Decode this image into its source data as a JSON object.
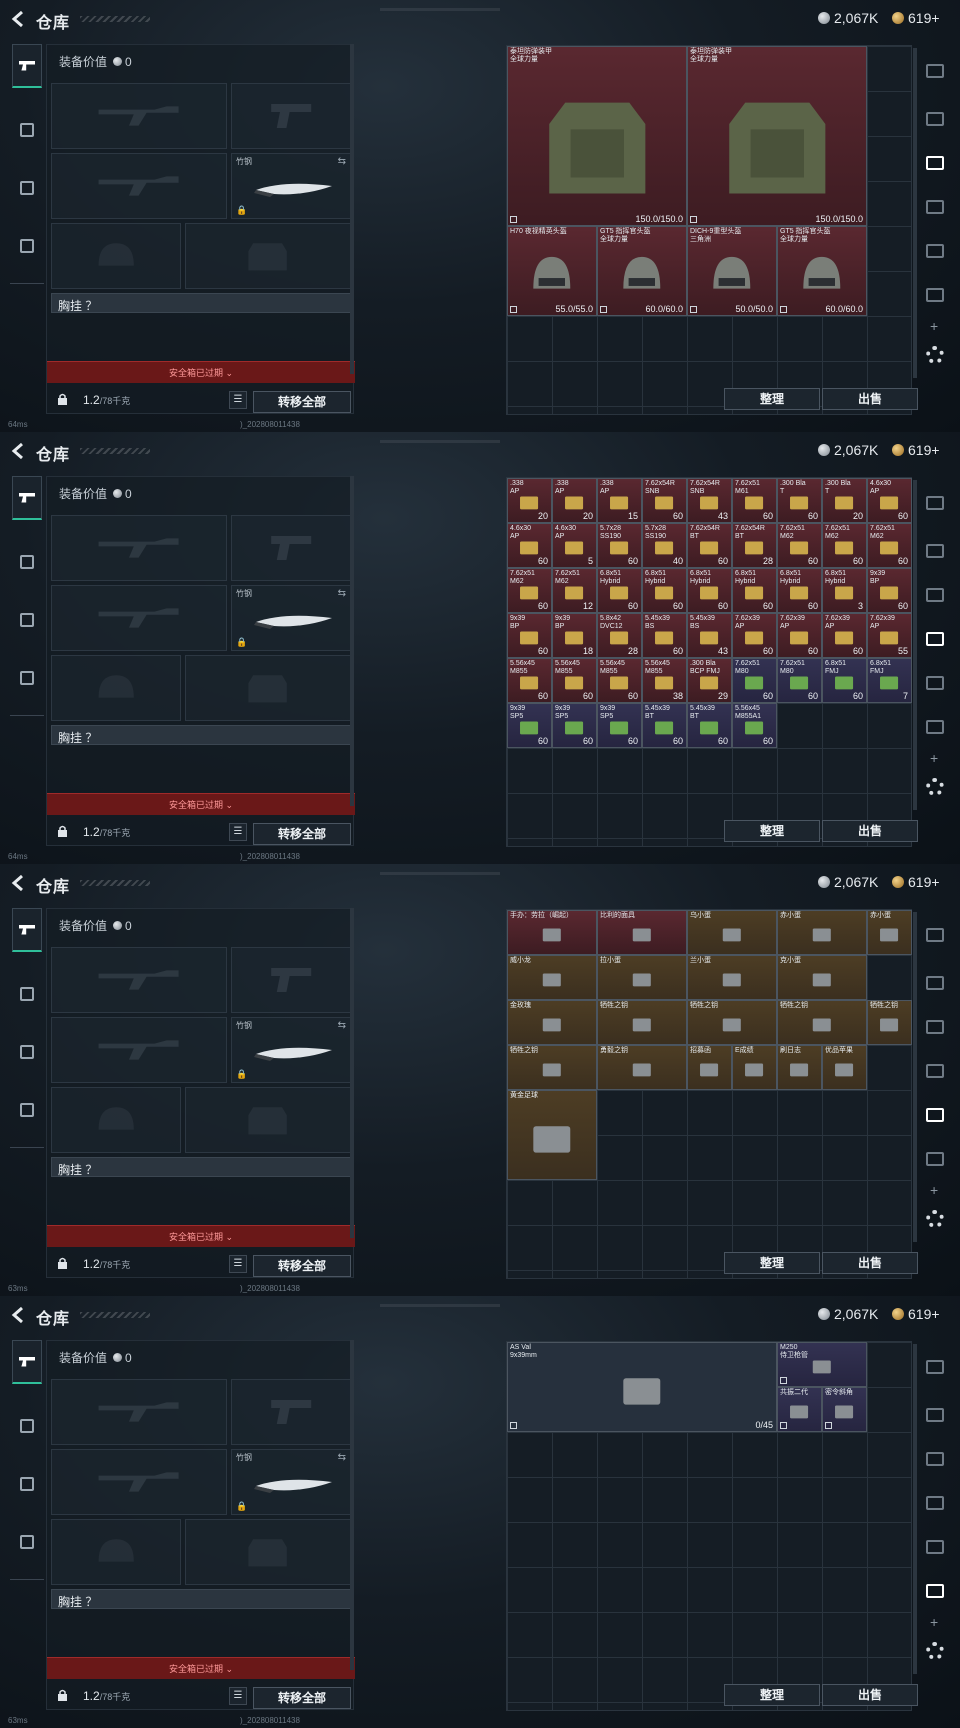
{
  "topbar": {
    "title": "仓库",
    "silver": "2,067K",
    "gold": "619+"
  },
  "loadout": {
    "gear_value_label": "装备价值",
    "gear_value": "0",
    "melee_label": "竹钢",
    "rig_label": "胸挂 ？",
    "expired": "安全箱已过期",
    "weight": "1.2",
    "weight_max": "/78千克",
    "transfer_all": "转移全部"
  },
  "actions": {
    "sort": "整理",
    "sell": "出售"
  },
  "status": {
    "ping_1": "64ms",
    "ping_2": "64ms",
    "ping_3": "63ms",
    "ping_4": "63ms",
    "build": ")_202808011438"
  },
  "colors": {
    "accent": "#2fbf9a",
    "expired_bg": "#6a1818",
    "rarity_red": "#5a2830",
    "rarity_gold": "#4d3d24",
    "rarity_purple": "#333252"
  },
  "icons": [
    "back-icon",
    "silver-coin-icon",
    "gold-coin-icon",
    "pistol-icon",
    "helmet-icon",
    "backpack-icon",
    "briefcase-icon",
    "lock-icon",
    "list-icon",
    "swap-icon",
    "plus-icon",
    "gear-icon"
  ],
  "panels": [
    {
      "items": [
        {
          "label": "泰坦防弹装甲\n全球力量",
          "qty": "150.0/150.0",
          "rarity": "red",
          "art": "armor"
        },
        {
          "label": "泰坦防弹装甲\n全球力量",
          "qty": "150.0/150.0",
          "rarity": "red",
          "art": "armor"
        },
        {
          "label": "H70 夜视精英头盔",
          "qty": "55.0/55.0",
          "rarity": "red",
          "art": "helmet"
        },
        {
          "label": "GT5 指挥官头盔\n全球力量",
          "qty": "60.0/60.0",
          "rarity": "red",
          "art": "helmet"
        },
        {
          "label": "DICH-9重型头盔\n三角洲",
          "qty": "50.0/50.0",
          "rarity": "red",
          "art": "helmet"
        },
        {
          "label": "GT5 指挥官头盔\n全球力量",
          "qty": "60.0/60.0",
          "rarity": "red",
          "art": "helmet"
        }
      ]
    },
    {
      "items": [
        {
          "label": ".338\nAP",
          "qty": "20",
          "rarity": "red"
        },
        {
          "label": ".338\nAP",
          "qty": "20",
          "rarity": "red"
        },
        {
          "label": ".338\nAP",
          "qty": "15",
          "rarity": "red"
        },
        {
          "label": "7.62x54R\nSNB",
          "qty": "60",
          "rarity": "red"
        },
        {
          "label": "7.62x54R\nSNB",
          "qty": "43",
          "rarity": "red"
        },
        {
          "label": "7.62x51\nM61",
          "qty": "60",
          "rarity": "red"
        },
        {
          "label": ".300 Bla\nT",
          "qty": "60",
          "rarity": "red"
        },
        {
          "label": ".300 Bla\nT",
          "qty": "20",
          "rarity": "red"
        },
        {
          "label": "4.6x30\nAP",
          "qty": "60",
          "rarity": "red"
        },
        {
          "label": "4.6x30\nAP",
          "qty": "60",
          "rarity": "red"
        },
        {
          "label": "4.6x30\nAP",
          "qty": "5",
          "rarity": "red"
        },
        {
          "label": "5.7x28\nSS190",
          "qty": "60",
          "rarity": "red"
        },
        {
          "label": "5.7x28\nSS190",
          "qty": "40",
          "rarity": "red"
        },
        {
          "label": "7.62x54R\nBT",
          "qty": "60",
          "rarity": "red"
        },
        {
          "label": "7.62x54R\nBT",
          "qty": "28",
          "rarity": "red"
        },
        {
          "label": "7.62x51\nM62",
          "qty": "60",
          "rarity": "red"
        },
        {
          "label": "7.62x51\nM62",
          "qty": "60",
          "rarity": "red"
        },
        {
          "label": "7.62x51\nM62",
          "qty": "60",
          "rarity": "red"
        },
        {
          "label": "7.62x51\nM62",
          "qty": "60",
          "rarity": "red"
        },
        {
          "label": "7.62x51\nM62",
          "qty": "12",
          "rarity": "red"
        },
        {
          "label": "6.8x51\nHybrid",
          "qty": "60",
          "rarity": "red"
        },
        {
          "label": "6.8x51\nHybrid",
          "qty": "60",
          "rarity": "red"
        },
        {
          "label": "6.8x51\nHybrid",
          "qty": "60",
          "rarity": "red"
        },
        {
          "label": "6.8x51\nHybrid",
          "qty": "60",
          "rarity": "red"
        },
        {
          "label": "6.8x51\nHybrid",
          "qty": "60",
          "rarity": "red"
        },
        {
          "label": "6.8x51\nHybrid",
          "qty": "3",
          "rarity": "red"
        },
        {
          "label": "9x39\nBP",
          "qty": "60",
          "rarity": "red"
        },
        {
          "label": "9x39\nBP",
          "qty": "60",
          "rarity": "red"
        },
        {
          "label": "9x39\nBP",
          "qty": "18",
          "rarity": "red"
        },
        {
          "label": "5.8x42\nDVC12",
          "qty": "28",
          "rarity": "red"
        },
        {
          "label": "5.45x39\nBS",
          "qty": "60",
          "rarity": "red"
        },
        {
          "label": "5.45x39\nBS",
          "qty": "43",
          "rarity": "red"
        },
        {
          "label": "7.62x39\nAP",
          "qty": "60",
          "rarity": "red"
        },
        {
          "label": "7.62x39\nAP",
          "qty": "60",
          "rarity": "red"
        },
        {
          "label": "7.62x39\nAP",
          "qty": "60",
          "rarity": "red"
        },
        {
          "label": "7.62x39\nAP",
          "qty": "55",
          "rarity": "red"
        },
        {
          "label": "5.56x45\nM855",
          "qty": "60",
          "rarity": "red"
        },
        {
          "label": "5.56x45\nM855",
          "qty": "60",
          "rarity": "red"
        },
        {
          "label": "5.56x45\nM855",
          "qty": "60",
          "rarity": "red"
        },
        {
          "label": "5.56x45\nM855",
          "qty": "38",
          "rarity": "red"
        },
        {
          "label": ".300 Bla\nBCP FMJ",
          "qty": "29",
          "rarity": "red"
        },
        {
          "label": "7.62x51\nM80",
          "qty": "60",
          "rarity": "purple"
        },
        {
          "label": "7.62x51\nM80",
          "qty": "60",
          "rarity": "purple"
        },
        {
          "label": "6.8x51\nFMJ",
          "qty": "60",
          "rarity": "purple"
        },
        {
          "label": "6.8x51\nFMJ",
          "qty": "7",
          "rarity": "purple"
        },
        {
          "label": "9x39\nSP5",
          "qty": "60",
          "rarity": "purple"
        },
        {
          "label": "9x39\nSP5",
          "qty": "60",
          "rarity": "purple"
        },
        {
          "label": "9x39\nSP5",
          "qty": "60",
          "rarity": "purple"
        },
        {
          "label": "5.45x39\nBT",
          "qty": "60",
          "rarity": "purple"
        },
        {
          "label": "5.45x39\nBT",
          "qty": "60",
          "rarity": "purple"
        },
        {
          "label": "5.56x45\nM855A1",
          "qty": "60",
          "rarity": "purple"
        }
      ]
    },
    {
      "items": [
        {
          "label": "手办：劳拉（崛起）",
          "rarity": "red"
        },
        {
          "label": "比利的面具",
          "rarity": "red"
        },
        {
          "label": "乌小蛋",
          "rarity": "gold"
        },
        {
          "label": "赤小蛋",
          "rarity": "gold"
        },
        {
          "label": "赤小蛋",
          "rarity": "gold"
        },
        {
          "label": "威小龙",
          "rarity": "gold"
        },
        {
          "label": "拉小蛋",
          "rarity": "gold"
        },
        {
          "label": "兰小蛋",
          "rarity": "gold"
        },
        {
          "label": "克小蛋",
          "rarity": "gold"
        },
        {
          "label": "金玫瑰",
          "rarity": "gold"
        },
        {
          "label": "牺牲之钥",
          "rarity": "gold"
        },
        {
          "label": "牺牲之钥",
          "rarity": "gold"
        },
        {
          "label": "牺牲之钥",
          "rarity": "gold"
        },
        {
          "label": "牺牲之钥",
          "rarity": "gold"
        },
        {
          "label": "牺牲之钥",
          "rarity": "gold"
        },
        {
          "label": "勇毅之钥",
          "rarity": "gold"
        },
        {
          "label": "招募函",
          "rarity": "gold"
        },
        {
          "label": "E成绩",
          "rarity": "gold"
        },
        {
          "label": "刷日志",
          "rarity": "gold"
        },
        {
          "label": "优品苹果",
          "rarity": "gold"
        },
        {
          "label": "黄金足球",
          "rarity": "gold"
        }
      ]
    },
    {
      "items": [
        {
          "label": "AS Val\n9x39mm",
          "qty": "0/45",
          "rarity": "blue"
        },
        {
          "label": "M250\n侍卫枪管",
          "rarity": "purple"
        },
        {
          "label": "共振二代",
          "rarity": "purple"
        },
        {
          "label": "密令斜角",
          "rarity": "purple"
        }
      ]
    }
  ]
}
